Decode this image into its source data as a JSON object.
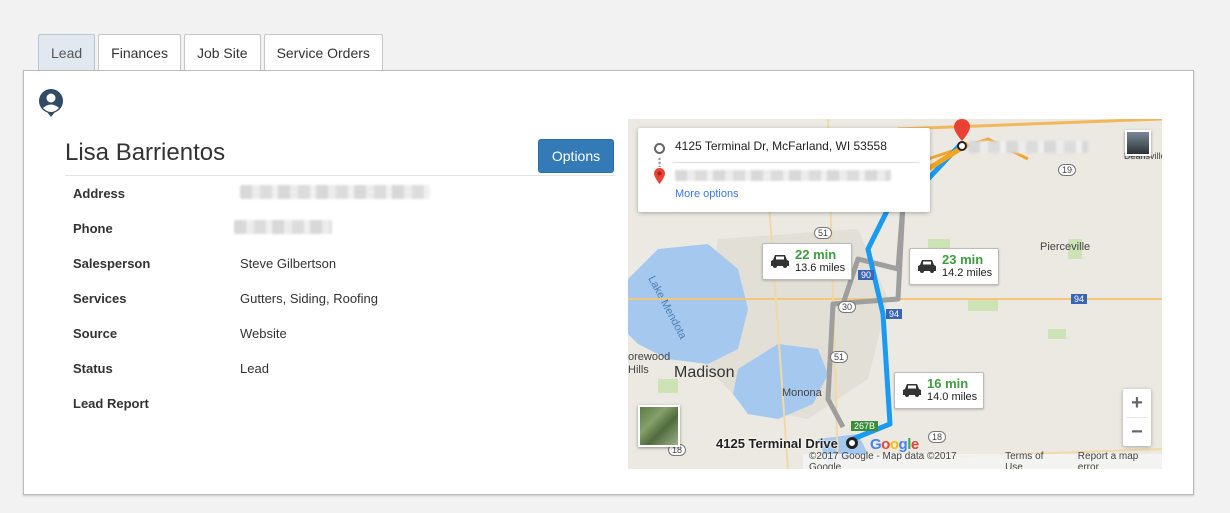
{
  "tabs": [
    {
      "label": "Lead",
      "active": true
    },
    {
      "label": "Finances",
      "active": false
    },
    {
      "label": "Job Site",
      "active": false
    },
    {
      "label": "Service Orders",
      "active": false
    }
  ],
  "customer": {
    "name": "Lisa Barrientos",
    "options_label": "Options"
  },
  "details": [
    {
      "label": "Address",
      "value": ""
    },
    {
      "label": "Phone",
      "value": ""
    },
    {
      "label": "Salesperson",
      "value": "Steve Gilbertson"
    },
    {
      "label": "Services",
      "value": "Gutters, Siding, Roofing"
    },
    {
      "label": "Source",
      "value": "Website"
    },
    {
      "label": "Status",
      "value": "Lead"
    },
    {
      "label": "Lead Report",
      "value": ""
    }
  ],
  "map": {
    "origin": "4125 Terminal Dr, McFarland, WI 53558",
    "more_options": "More options",
    "routes": [
      {
        "time": "22 min",
        "distance": "13.6 miles"
      },
      {
        "time": "23 min",
        "distance": "14.2 miles"
      },
      {
        "time": "16 min",
        "distance": "14.0 miles"
      }
    ],
    "places": {
      "madison": "Madison",
      "monona": "Monona",
      "pierceville": "Pierceville",
      "lake_mendota": "Lake Mendota",
      "deansville": "Deansville",
      "shorewood": "orewood",
      "hills": "Hills",
      "terminal": "4125 Terminal Drive"
    },
    "shields": [
      "51",
      "90",
      "94",
      "30",
      "51",
      "19",
      "94",
      "18",
      "18",
      "267B"
    ],
    "google": "Google",
    "attribution": "©2017 Google - Map data ©2017 Google",
    "terms": "Terms of Use",
    "report": "Report a map error",
    "zoom_in": "+",
    "zoom_out": "−",
    "colors": {
      "primary_route": "#1a9af0",
      "alt_route": "#9e9e9e",
      "water": "#a5c8ee"
    }
  }
}
